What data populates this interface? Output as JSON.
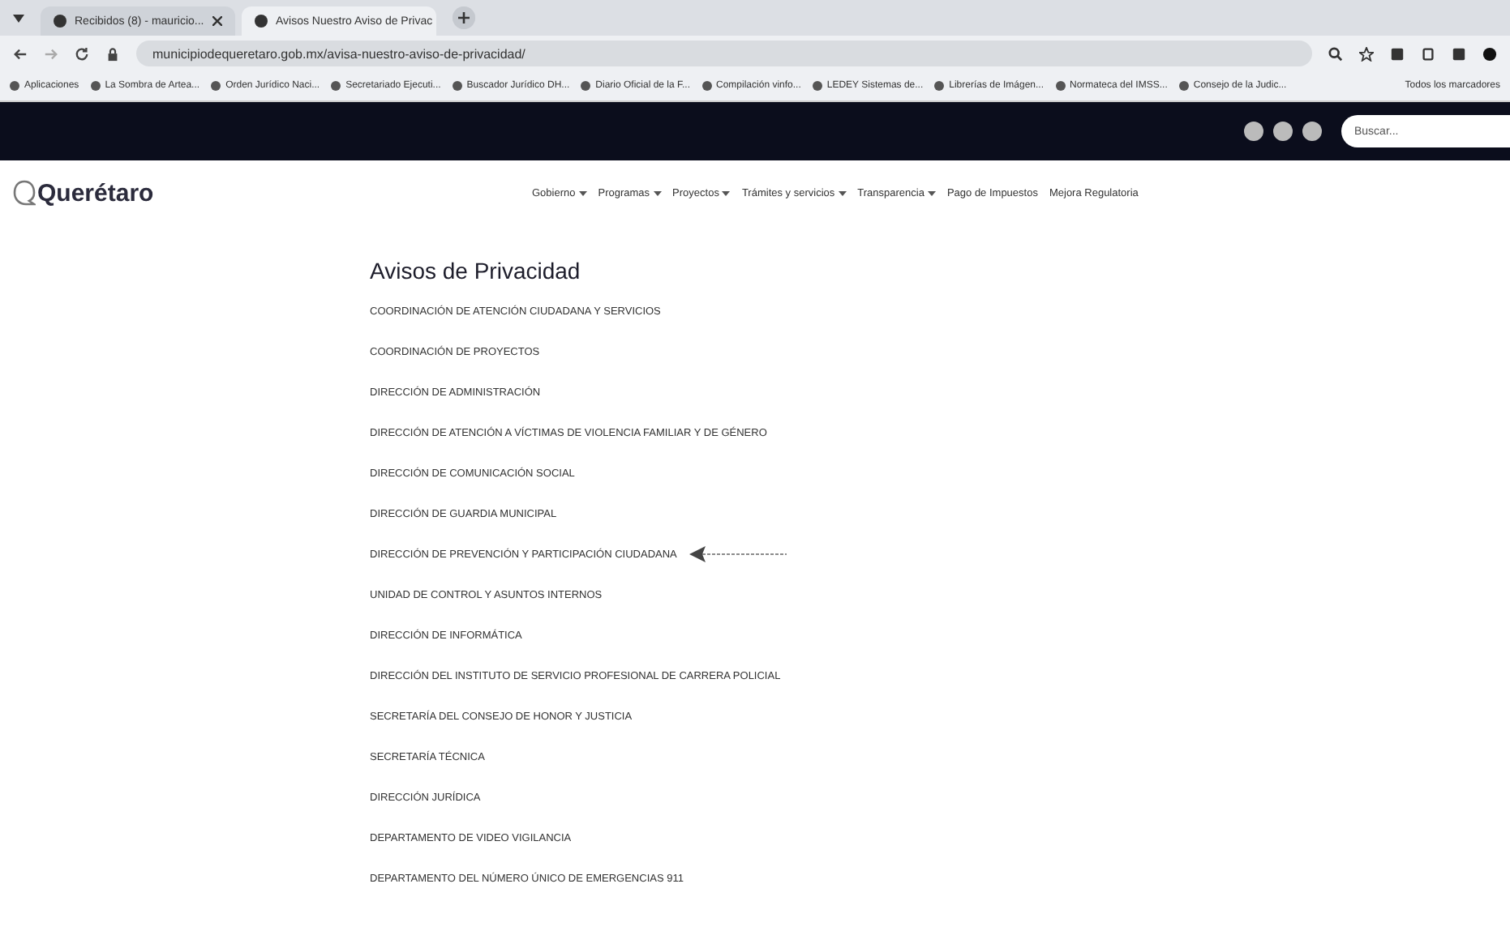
{
  "browser": {
    "tabs": [
      {
        "title": "Recibidos (8) - mauricio...",
        "selected": false
      },
      {
        "title": "Avisos Nuestro Aviso de Privac",
        "selected": true
      }
    ],
    "url": "municipiodequeretaro.gob.mx/avisa-nuestro-aviso-de-privacidad/",
    "bookmarks": [
      "Aplicaciones",
      "La Sombra de Artea...",
      "Orden Jurídico Naci...",
      "Secretariado Ejecuti...",
      "Buscador Jurídico DH...",
      "Diario Oficial de la F...",
      "Compilación vinfo...",
      "LEDEY Sistemas de...",
      "Librerías de Imágen...",
      "Normateca del IMSS...",
      "Consejo de la Judic..."
    ],
    "all_bookmarks": "Todos los marcadores"
  },
  "site": {
    "search": {
      "placeholder": "Buscar..."
    },
    "logo": "Querétaro",
    "nav": [
      {
        "label": "Gobierno",
        "dropdown": true
      },
      {
        "label": "Programas",
        "dropdown": true
      },
      {
        "label": "Proyectos",
        "dropdown": true
      },
      {
        "label": "Trámites y servicios",
        "dropdown": true
      },
      {
        "label": "Transparencia",
        "dropdown": true
      },
      {
        "label": "Pago de Impuestos",
        "dropdown": false
      },
      {
        "label": "Mejora Regulatoria",
        "dropdown": false
      }
    ]
  },
  "page": {
    "title": "Avisos de Privacidad",
    "links": [
      {
        "label": "COORDINACIÓN DE ATENCIÓN CIUDADANA Y SERVICIOS",
        "marked": false
      },
      {
        "label": "COORDINACIÓN DE PROYECTOS",
        "marked": false
      },
      {
        "label": "DIRECCIÓN DE ADMINISTRACIÓN",
        "marked": false
      },
      {
        "label": "DIRECCIÓN DE ATENCIÓN A VÍCTIMAS DE VIOLENCIA FAMILIAR Y DE GÉNERO",
        "marked": false
      },
      {
        "label": "DIRECCIÓN DE COMUNICACIÓN SOCIAL",
        "marked": false
      },
      {
        "label": "DIRECCIÓN DE GUARDIA MUNICIPAL",
        "marked": false
      },
      {
        "label": "DIRECCIÓN DE PREVENCIÓN Y PARTICIPACIÓN CIUDADANA",
        "marked": true
      },
      {
        "label": "UNIDAD DE CONTROL Y ASUNTOS INTERNOS",
        "marked": false
      },
      {
        "label": "DIRECCIÓN DE INFORMÁTICA",
        "marked": false
      },
      {
        "label": "DIRECCIÓN DEL INSTITUTO DE SERVICIO PROFESIONAL DE CARRERA POLICIAL",
        "marked": false
      },
      {
        "label": "SECRETARÍA DEL CONSEJO DE HONOR Y JUSTICIA",
        "marked": false
      },
      {
        "label": "SECRETARÍA TÉCNICA",
        "marked": false
      },
      {
        "label": "DIRECCIÓN JURÍDICA",
        "marked": false
      },
      {
        "label": "DEPARTAMENTO DE VIDEO VIGILANCIA",
        "marked": false
      },
      {
        "label": "DEPARTAMENTO DEL NÚMERO ÚNICO DE EMERGENCIAS 911",
        "marked": false
      }
    ]
  }
}
